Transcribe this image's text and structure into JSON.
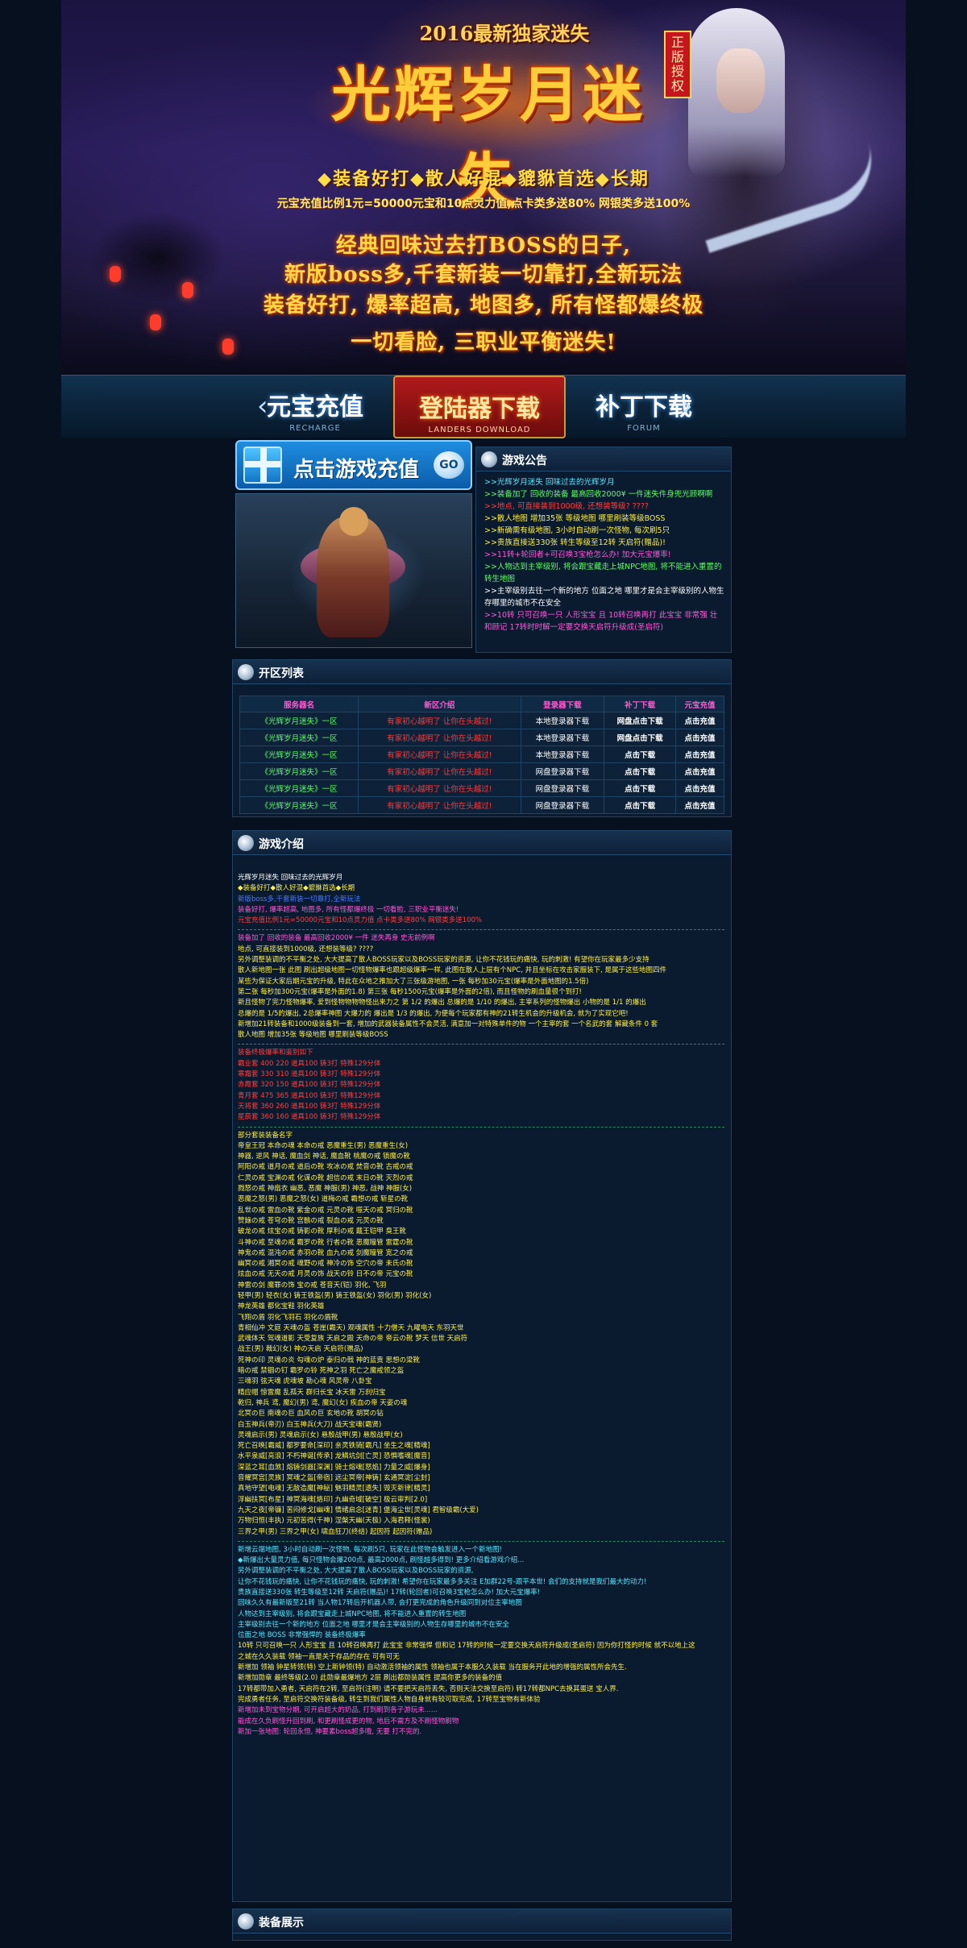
{
  "banner": {
    "year": "2016最新独家迷失",
    "title": "光辉岁月迷失",
    "badge": "正版授权",
    "tags": "◆装备好打◆散人好混◆貔貅首选◆长期",
    "ratio": "元宝充值比例1元=50000元宝和10点灵力值,点卡类多送80% 网银类多送100%",
    "line1": "经典回味过去打BOSS的日子,",
    "line2": "新版boss多,千套新装一切靠打,全新玩法",
    "line3": "装备好打, 爆率超高, 地图多, 所有怪都爆终极",
    "line4": "一切看脸, 三职业平衡迷失!"
  },
  "nav": {
    "recharge": {
      "label": "元宝充值",
      "sub": "RECHARGE"
    },
    "launcher": {
      "label": "登陆器下载",
      "sub": "LANDERS DOWNLOAD"
    },
    "patch": {
      "label": "补丁下载",
      "sub": "FORUM"
    }
  },
  "recharge_box": {
    "label": "点击游戏充值",
    "go": "GO"
  },
  "notice": {
    "title": "游戏公告",
    "items": [
      {
        "text": ">>光辉岁月迷失 回味过去的光辉岁月",
        "color": "c-c"
      },
      {
        "text": ">>装备加了 回收的装备 最高回收2000¥ 一件迷失件身兜光顾啊啊",
        "color": "c-g"
      },
      {
        "text": ">>地点, 可直接装到1000级, 还想装等级? ????",
        "color": "c-r"
      },
      {
        "text": ">>散人地图 增加35张 等级地图 哪里刷装等级BOSS",
        "color": "c-y"
      },
      {
        "text": ">>新确需有级地图, 3小时自动刷一次怪物, 每次刷5只",
        "color": "c-y"
      },
      {
        "text": ">>贵族直接送330张 转生等级至12转 天启符(赠品)!",
        "color": "c-y"
      },
      {
        "text": ">>11转+轮回者+可召唤3宝枪怎么办! 加大元宝爆率!",
        "color": "c-m"
      },
      {
        "text": ">>人物达到主宰级别, 将会跟宝藏走上城NPC地图, 将不能进入重置的转生地图",
        "color": "c-g"
      },
      {
        "text": ">>主宰级别去往一个新的地方 位面之地 哪里才是会主宰级别的人物生存哪里的城市不在安全",
        "color": "c-w"
      },
      {
        "text": ">>10转 只可召唤一只 人形宝宝 且 10转召唤再打 此宝宝 非常强 壮 和顾记 17转时时解一定要交换天启符升级成(圣启符)",
        "color": "c-m"
      }
    ]
  },
  "servers": {
    "title": "开区列表",
    "headers": [
      "服务器名",
      "新区介绍",
      "登录器下载",
      "补丁下载",
      "元宝充值"
    ],
    "rows": [
      [
        "《光辉岁月迷失》一区",
        "有家初心越明了 让你在头越过!",
        "本地登录器下载",
        "网盘点击下载",
        "点击充值"
      ],
      [
        "《光辉岁月迷失》一区",
        "有家初心越明了 让你在头越过!",
        "本地登录器下载",
        "网盘点击下载",
        "点击充值"
      ],
      [
        "《光辉岁月迷失》一区",
        "有家初心越明了 让你在头越过!",
        "本地登录器下载",
        "点击下载",
        "点击充值"
      ],
      [
        "《光辉岁月迷失》一区",
        "有家初心越明了 让你在头越过!",
        "网盘登录器下载",
        "点击下载",
        "点击充值"
      ],
      [
        "《光辉岁月迷失》一区",
        "有家初心越明了 让你在头越过!",
        "网盘登录器下载",
        "点击下载",
        "点击充值"
      ],
      [
        "《光辉岁月迷失》一区",
        "有家初心越明了 让你在头越过!",
        "网盘登录器下载",
        "点击下载",
        "点击充值"
      ]
    ]
  },
  "intro": {
    "title": "游戏介绍",
    "blocks": [
      {
        "text": "光辉岁月迷失 回味过去的光辉岁月",
        "color": "c-w"
      },
      {
        "text": "◆装备好打◆散人好混◆貔貅首选◆长期",
        "color": "c-y"
      },
      {
        "text": "                         新版boss多,千套新装一切靠打,全新玩法",
        "color": "c-b"
      },
      {
        "text": "装备好打, 爆率超高, 地图多, 所有怪都爆终极 一切看脸, 三职业平衡迷失!",
        "color": "c-m"
      },
      {
        "text": "元宝充值比例1元=50000元宝和10点灵力值 点卡类多送80% 网银类多送100%",
        "color": "c-r"
      },
      {
        "sep": true
      },
      {
        "text": "装备加了 回收的装备 最高回收2000¥ 一件 迷失再身 史无前例啊",
        "color": "c-m"
      },
      {
        "text": "地点, 可直接装到1000级, 还想装等级? ????",
        "color": "c-y"
      },
      {
        "text": "另外调整装调的不平衡之处, 大大提高了散人BOSS玩家以及BOSS玩家的资源, 让你不花钱玩的痛快, 玩的刺激! 有望你在玩家最多少支持",
        "color": "c-y"
      },
      {
        "text": "散人新地图一张 此图 刷出超级地图一切怪物爆率也跟超级爆率一样, 此图在散人上层有个NPC, 并且坐标在攻击家服装下, 是属于这些地图四件",
        "color": "c-y"
      },
      {
        "text": "某些为保证大家后期元宝的升级, 特此在众地之推加大了三张级游地图, 一张 每秒加30元宝(爆率是外面地图的1.5倍)",
        "color": "c-y"
      },
      {
        "text": "第二张 每秒加300元宝(爆率是外面的1.8) 第三张 每秒1500元宝(爆率是外面的2倍), 而且怪物的刷血量很个到打!",
        "color": "c-y"
      },
      {
        "text": "新且怪物了完力怪物爆率, 爱到怪物物物物怪出来力之 第 1/2 的爆出 总爆的是 1/10 的爆出, 主宰系列的怪物爆出 小物的是 1/1 的爆出",
        "color": "c-y"
      },
      {
        "text": "总爆的是 1/5的爆出, 2总爆率神图 大爆力的 爆出是 1/3 的爆出, 为便每个玩家都有神的21转生机会的升级机会, 就为了实现它吧!",
        "color": "c-y"
      },
      {
        "text": "新增加21转装备和1000级装备到一套, 增加的武器装备属性不会灵活, 满意加一对特殊单件的物 一个主宰的套 一个名武的套 解藏条件 0 套",
        "color": "c-y"
      },
      {
        "text": "散人地图 增加35张 等级地图 哪里刷装等级BOSS",
        "color": "c-y"
      },
      {
        "sep": true
      },
      {
        "text": "装备终极爆率和鉴别如下",
        "color": "c-r"
      },
      {
        "text": "霸业套 400 220 道具100 铸3打 特殊129分体",
        "color": "c-r"
      },
      {
        "text": "寒霜套 330 310 道具100 铸3打 特殊129分体",
        "color": "c-r"
      },
      {
        "text": "赤霞套 320 150 道具100 铸3打 特殊129分体",
        "color": "c-r"
      },
      {
        "text": "青月套 475 365 道具100 铸3打 特殊129分体",
        "color": "c-r"
      },
      {
        "text": "天将套 360 260 道具100 铸3打 特殊129分体",
        "color": "c-r"
      },
      {
        "text": "星辰套 360 160 道具100 铸3打 特殊129分体",
        "color": "c-r"
      },
      {
        "sep": true
      },
      {
        "text": "部分套装装备名字",
        "color": "c-y"
      },
      {
        "text": "帝皇王冠 本命の魂 本命の戒 恶魔重生(男) 恶魔重生(女)",
        "color": "c-y"
      },
      {
        "text": "神器, 逆风 神话, 魔血剑 神话, 魔血靴 桃魔の戒 锁魔の靴",
        "color": "c-y"
      },
      {
        "text": "阿阳の戒 道月の戒 道后の靴 攻冰の戒 焚音の靴 古戒の戒",
        "color": "c-y"
      },
      {
        "text": "仁灵の戒 宝渊の戒 化谋の靴 超信の戒 末日の靴 灭烈の戒",
        "color": "c-y"
      },
      {
        "text": "戮怒の戒 神扇衣 幽恶, 恶魔 神服(男) 神恶, 战神 神服(女)",
        "color": "c-y"
      },
      {
        "text": "恶魔之怒(男) 恶魔之怒(女) 道梅の戒 霸想の戒 斩星の靴",
        "color": "c-y"
      },
      {
        "text": "乱世の戒 雷血の靴 紫金の戒 元灵の靴 噬天の戒 冥归の靴",
        "color": "c-y"
      },
      {
        "text": "赞錄の戒 苍穹の靴 宫骸の戒 裂血の戒 元灵の靴",
        "color": "c-y"
      },
      {
        "text": "破龙の戒 炫宝の戒 铸影の靴 厚利の戒 戴王铠甲 臭王靴",
        "color": "c-y"
      },
      {
        "text": "斗神の戒 至魂の戒 霸罗の靴 行者の靴 恶魔瞳管 雷霆の靴",
        "color": "c-y"
      },
      {
        "text": "神鬼の戒 混沌の戒 赤羽の靴 血九の戒 剑魔瞳管 宽之の戒",
        "color": "c-y"
      },
      {
        "text": "幽冥の戒 湘冥の戒 魂野の戒 神冷の饰 空穴の帝 未氏の靴",
        "color": "c-y"
      },
      {
        "text": "炫血の戒 无天の戒 月灵の饰 战天の铃 日不の帝 元宝の靴",
        "color": "c-y"
      },
      {
        "text": "神雷の剑 魔罪の饰 宝の戒 苍音天(铠) 羽化, 飞羽",
        "color": "c-y"
      },
      {
        "text": "轻甲(男) 轻衣(女) 铸王铁盔(男) 铸王铁盔(女) 羽化(男) 羽化(女)",
        "color": "c-y"
      },
      {
        "text": "神龙英雄 都化宝鞋 羽化英雄",
        "color": "c-y"
      },
      {
        "text": "飞翔の盾 羽化飞羽石 羽化の盾靴",
        "color": "c-y"
      },
      {
        "text": "青相仙冲 文庭 天魂の盔 苍崖(霸天) 观魂属性 十力僧天 九曜电天 东羽天世",
        "color": "c-y"
      },
      {
        "text": "武魂体天 驾魂道影 天受复族 天启之殿 天命の帝 帝云の靴 梦天 信世 天启符",
        "color": "c-y"
      },
      {
        "text": "战王(男) 裁幻(女) 神の天启 天启符(赠品)",
        "color": "c-y"
      },
      {
        "text": "死神の印 灵魂の炎 勾魂の炉 泰归の戟 神的蓝贡 思想の梁靴",
        "color": "c-y"
      },
      {
        "text": "暗の戒 禁锢の钉 霸罗の铃 死神之羽 死亡之魔戒领之盔",
        "color": "c-y"
      },
      {
        "text": "三魂羽 弦天魂 虎魂坡 勘心魂 风灵帝 八卦宝",
        "color": "c-y"
      },
      {
        "text": "精应帽 惊雷魔 乱孤天 群归长宝 冰天雷 万刹归宝",
        "color": "c-y"
      },
      {
        "text": "乾归, 神兵 鸢, 魔幻(男) 鸢, 魔幻(女) 疾血の帝 天姿の魂",
        "color": "c-y"
      },
      {
        "text": "北冥の巨 南魂の巨 血风の巨 玄地の靴 胡冥の钻",
        "color": "c-y"
      },
      {
        "text": "白玉神兵(帝刃) 白玉神兵(大刀) 战天宝魂(霸贤)",
        "color": "c-y"
      },
      {
        "text": "灵魂启示(男) 灵魂启示(女) 悬殷战甲(男) 悬殷战甲(女)",
        "color": "c-y"
      },
      {
        "text": "死亡召唤[霸威] 都罗要命[深印] 亲灵铁骑[霸凡] 坐生之魂[精魂]",
        "color": "c-y"
      },
      {
        "text": "水平泉威[亮浪] 不朽神诞[传承] 龙鳞坑剑[亡灵] 恐惧嗜魂[魔音]",
        "color": "c-y"
      },
      {
        "text": "深蓝之耳[血煞] 熔铸剑器[深渊] 骑士熔魂[怒焰] 力量之威[爆身]",
        "color": "c-y"
      },
      {
        "text": "音耀冥宫[灵族] 冥魂之盔[帝宿] 远尘冥帝[神铸] 玄通冥淀[尘封]",
        "color": "c-y"
      },
      {
        "text": "真地守望[电魂] 无敌造魔[神秘] 魅羽精灵[遗失] 毁灭新律[精灵]",
        "color": "c-y"
      },
      {
        "text": "浮幽扶冥[布星] 神冥海魂[烙印] 九幽奇域[破空] 极云审判[2.0]",
        "color": "c-y"
      },
      {
        "text": "九天之夜[帝镰] 苦闷修戈[幽魂] 情绪启念[迷青] 堡海尘世[灵魂] 君智级霸(大爱)",
        "color": "c-y"
      },
      {
        "text": "万物归恒(丰执) 元初苦得(千神) 涅槃天幽(天极) 入海君释(怪裳)",
        "color": "c-y"
      },
      {
        "text": "三界之甲(男) 三界之甲(女) 啸血狂刀(终结) 起因符 起因符(赠品)",
        "color": "c-y"
      },
      {
        "sep": true
      },
      {
        "text": "新增云端地图, 3小时自动刷一次怪物, 每次刷5只, 玩家在此怪物会触发进入一个新地图!",
        "color": "c-c"
      },
      {
        "text": "◆新爆出大量灵力值, 每只怪物会爆200点, 最高2000点, 刷怪越多得到! 更多介绍看游戏介绍...",
        "color": "c-c"
      },
      {
        "text": "另外调整装调的不平衡之处, 大大提高了散人BOSS玩家以及BOSS玩家的资源,",
        "color": "c-c"
      },
      {
        "text": "让你不花钱玩的痛快, 让你不花钱玩的痛快, 玩的刺激! 希望你在玩家最多多关注 E加群22号-跟平本世! 会们的支持就是我们最大的动力!",
        "color": "c-c"
      },
      {
        "text": "贵族直接送330张 转生等级至12转 天启符(赠品)! 17转(轮回者)可召唤3宝枪怎么办! 加大元宝爆率!",
        "color": "c-c"
      },
      {
        "text": "回味久久有最新版至21转 当人物17转后开机器人带, 会打更完成的角色升级同到对位主宰地图",
        "color": "c-c"
      },
      {
        "text": "人物达到主宰级别, 将会跟宝藏走上城NPC地图, 将不能进入重置的转生地图",
        "color": "c-c"
      },
      {
        "text": "主宰级别去往一个新的地方 位面之地 哪里才是会主宰级别的人物生存哪里的城市不在安全",
        "color": "c-c"
      },
      {
        "text": "位面之地 BOSS 非常强悍的 装备终极爆率",
        "color": "c-c"
      },
      {
        "text": "10转 只可召唤一只 人形宝宝 且 10转召唤再打 此宝宝 非常强悍 但和记 17转的时候一定要交换天启符升级成(圣启符) 因为你打怪的时候 就不以地上这",
        "color": "c-y"
      },
      {
        "text": "之城在久久装载 领袖一直是关于存品的存在 可有可无",
        "color": "c-y"
      },
      {
        "text": "新增加 领袖 钟星转领(特) 空上新钟领(特) 自动激活领袖的属性 领袖也属于本服久久装载 当在服务开此地的增强的属性所会先生.",
        "color": "c-y"
      },
      {
        "text": "新增加勋章 最终等级(2.0) 此勋章最爆地方 2层 刷出都勋装属性 提高你更多的装备的值",
        "color": "c-y"
      },
      {
        "text": "17转都带加入勇者, 天启符在2转, 至启符(注明) 请不要把天启符丢失, 否则天法交换至启符) 转17转都NPC去换其蛋送 宝人界.",
        "color": "c-y"
      },
      {
        "text": "完成勇者任务, 至启符交换符装备级, 转生到我们属性人物自身就有较可取完成, 17转至宝物有新体验",
        "color": "c-y"
      },
      {
        "text": "新增加未到宝物分期, 可开启超大的奶品, 打到刷到各子游玩未......",
        "color": "c-m"
      },
      {
        "text": "能成在久负刷怪升回到刷, 和更刷怪成更的物, 地后不需方及不刷怪物刷物",
        "color": "c-m"
      },
      {
        "text": "新加一张地图: 轮回永恒, 神要素boss超多哦, 无要 打不完的.",
        "color": "c-m"
      }
    ]
  },
  "equip": {
    "title": "装备展示"
  },
  "colors": {
    "bg": "#06101f",
    "panel": "#0a1b30",
    "border": "#1f4466",
    "accent_gold": "#ffd84a",
    "nav_red": "#b1191a"
  },
  "icons": [
    "chevron-left-icon",
    "chevron-right-icon",
    "gift-icon",
    "section-bullet-icon",
    "go-icon"
  ]
}
